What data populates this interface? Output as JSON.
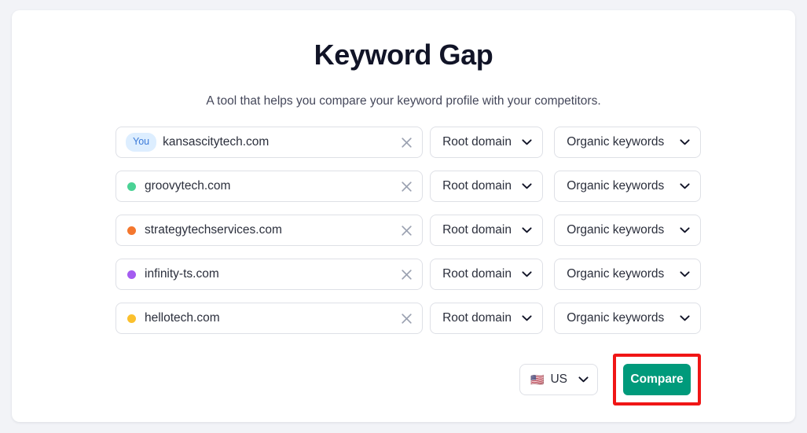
{
  "page": {
    "title": "Keyword Gap",
    "subtitle": "A tool that helps you compare your keyword profile with your competitors."
  },
  "rows": [
    {
      "badge": "You",
      "dot_color": null,
      "domain": "kansascitytech.com",
      "clear_icon": "close-icon",
      "scope": "Root domain",
      "metric": "Organic keywords"
    },
    {
      "badge": null,
      "dot_color": "#4ad295",
      "domain": "groovytech.com",
      "clear_icon": "close-icon",
      "scope": "Root domain",
      "metric": "Organic keywords"
    },
    {
      "badge": null,
      "dot_color": "#f4772e",
      "domain": "strategytechservices.com",
      "clear_icon": "close-icon",
      "scope": "Root domain",
      "metric": "Organic keywords"
    },
    {
      "badge": null,
      "dot_color": "#a45cf0",
      "domain": "infinity-ts.com",
      "clear_icon": "close-icon",
      "scope": "Root domain",
      "metric": "Organic keywords"
    },
    {
      "badge": null,
      "dot_color": "#fbc02d",
      "domain": "hellotech.com",
      "clear_icon": "close-icon",
      "scope": "Root domain",
      "metric": "Organic keywords"
    }
  ],
  "footer": {
    "country_flag": "🇺🇸",
    "country_code": "US",
    "compare_label": "Compare"
  },
  "colors": {
    "accent_teal": "#009a7b",
    "highlight_red": "#f01616",
    "badge_bg": "#ddeeff",
    "badge_text": "#3b7ad9",
    "page_bg": "#f2f3f7",
    "card_bg": "#ffffff",
    "border": "#dee0e6",
    "title_text": "#111427"
  }
}
